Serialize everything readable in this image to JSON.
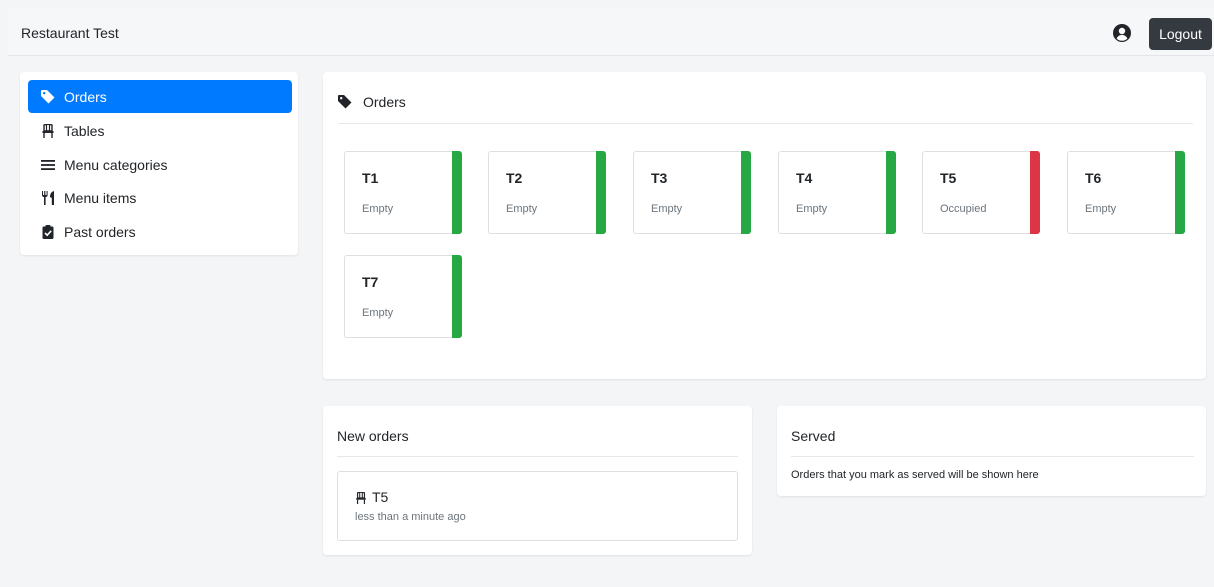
{
  "navbar": {
    "brand": "Restaurant Test",
    "logout_label": "Logout",
    "user_icon": "user-circle-icon"
  },
  "sidebar": {
    "items": [
      {
        "label": "Orders",
        "icon": "tag-icon",
        "active": true
      },
      {
        "label": "Tables",
        "icon": "chair-icon",
        "active": false
      },
      {
        "label": "Menu categories",
        "icon": "list-icon",
        "active": false
      },
      {
        "label": "Menu items",
        "icon": "utensils-icon",
        "active": false
      },
      {
        "label": "Past orders",
        "icon": "clipboard-check-icon",
        "active": false
      }
    ]
  },
  "orders": {
    "title": "Orders",
    "tables": [
      {
        "name": "T1",
        "status": "Empty",
        "status_color": "#28a745"
      },
      {
        "name": "T2",
        "status": "Empty",
        "status_color": "#28a745"
      },
      {
        "name": "T3",
        "status": "Empty",
        "status_color": "#28a745"
      },
      {
        "name": "T4",
        "status": "Empty",
        "status_color": "#28a745"
      },
      {
        "name": "T5",
        "status": "Occupied",
        "status_color": "#dc3545"
      },
      {
        "name": "T6",
        "status": "Empty",
        "status_color": "#28a745"
      },
      {
        "name": "T7",
        "status": "Empty",
        "status_color": "#28a745"
      }
    ]
  },
  "new_orders": {
    "title": "New orders",
    "items": [
      {
        "table": "T5",
        "time": "less than a minute ago"
      }
    ]
  },
  "served": {
    "title": "Served",
    "empty_message": "Orders that you mark as served will be shown here"
  },
  "colors": {
    "accent": "#007bff",
    "logout_bg": "#343a40",
    "empty": "#28a745",
    "occupied": "#dc3545"
  }
}
